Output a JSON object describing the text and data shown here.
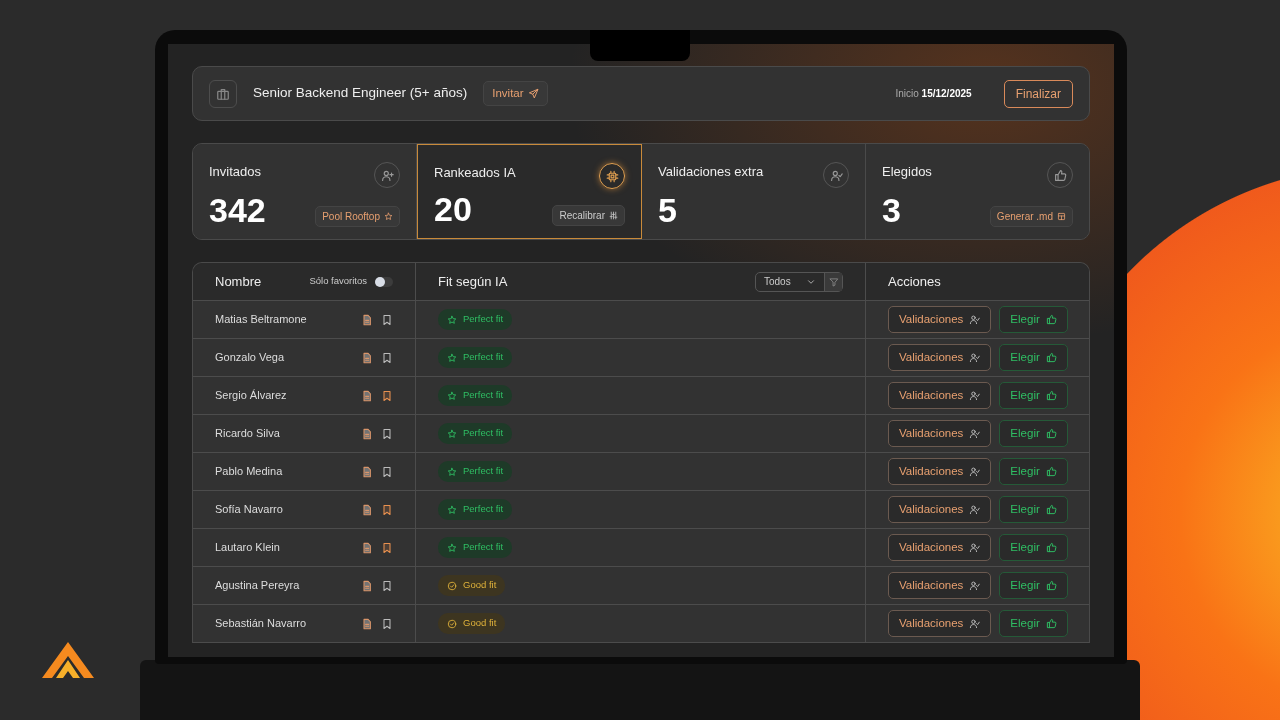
{
  "job": {
    "title": "Senior Backend Engineer (5+ años)",
    "invite_label": "Invitar",
    "start_label": "Inicio",
    "start_date": "15/12/2025",
    "finish_label": "Finalizar"
  },
  "stats": [
    {
      "label": "Invitados",
      "value": "342",
      "action": "Pool Rooftop",
      "selected": false
    },
    {
      "label": "Rankeados IA",
      "value": "20",
      "action": "Recalibrar",
      "selected": true
    },
    {
      "label": "Validaciones extra",
      "value": "5",
      "selected": false
    },
    {
      "label": "Elegidos",
      "value": "3",
      "action": "Generar .md",
      "selected": false
    }
  ],
  "table": {
    "columns": [
      "Nombre",
      "Fit según IA",
      "Acciones"
    ],
    "favorites_toggle": {
      "label": "Sólo favoritos",
      "on": false
    },
    "filter": {
      "value": "Todos"
    },
    "rows": [
      {
        "name": "Matias Beltramone",
        "favorite": false,
        "fit": "Perfect fit",
        "kind": "perfect",
        "validate": "Validaciones",
        "choose": "Elegir"
      },
      {
        "name": "Gonzalo Vega",
        "favorite": false,
        "fit": "Perfect fit",
        "kind": "perfect",
        "validate": "Validaciones",
        "choose": "Elegir"
      },
      {
        "name": "Sergio Álvarez",
        "favorite": true,
        "fit": "Perfect fit",
        "kind": "perfect",
        "validate": "Validaciones",
        "choose": "Elegir"
      },
      {
        "name": "Ricardo Silva",
        "favorite": false,
        "fit": "Perfect fit",
        "kind": "perfect",
        "validate": "Validaciones",
        "choose": "Elegir"
      },
      {
        "name": "Pablo Medina",
        "favorite": false,
        "fit": "Perfect fit",
        "kind": "perfect",
        "validate": "Validaciones",
        "choose": "Elegir"
      },
      {
        "name": "Sofía Navarro",
        "favorite": true,
        "fit": "Perfect fit",
        "kind": "perfect",
        "validate": "Validaciones",
        "choose": "Elegir"
      },
      {
        "name": "Lautaro Klein",
        "favorite": true,
        "fit": "Perfect fit",
        "kind": "perfect",
        "validate": "Validaciones",
        "choose": "Elegir"
      },
      {
        "name": "Agustina Pereyra",
        "favorite": false,
        "fit": "Good fit",
        "kind": "good",
        "validate": "Validaciones",
        "choose": "Elegir"
      },
      {
        "name": "Sebastián Navarro",
        "favorite": false,
        "fit": "Good fit",
        "kind": "good",
        "validate": "Validaciones",
        "choose": "Elegir"
      }
    ]
  }
}
